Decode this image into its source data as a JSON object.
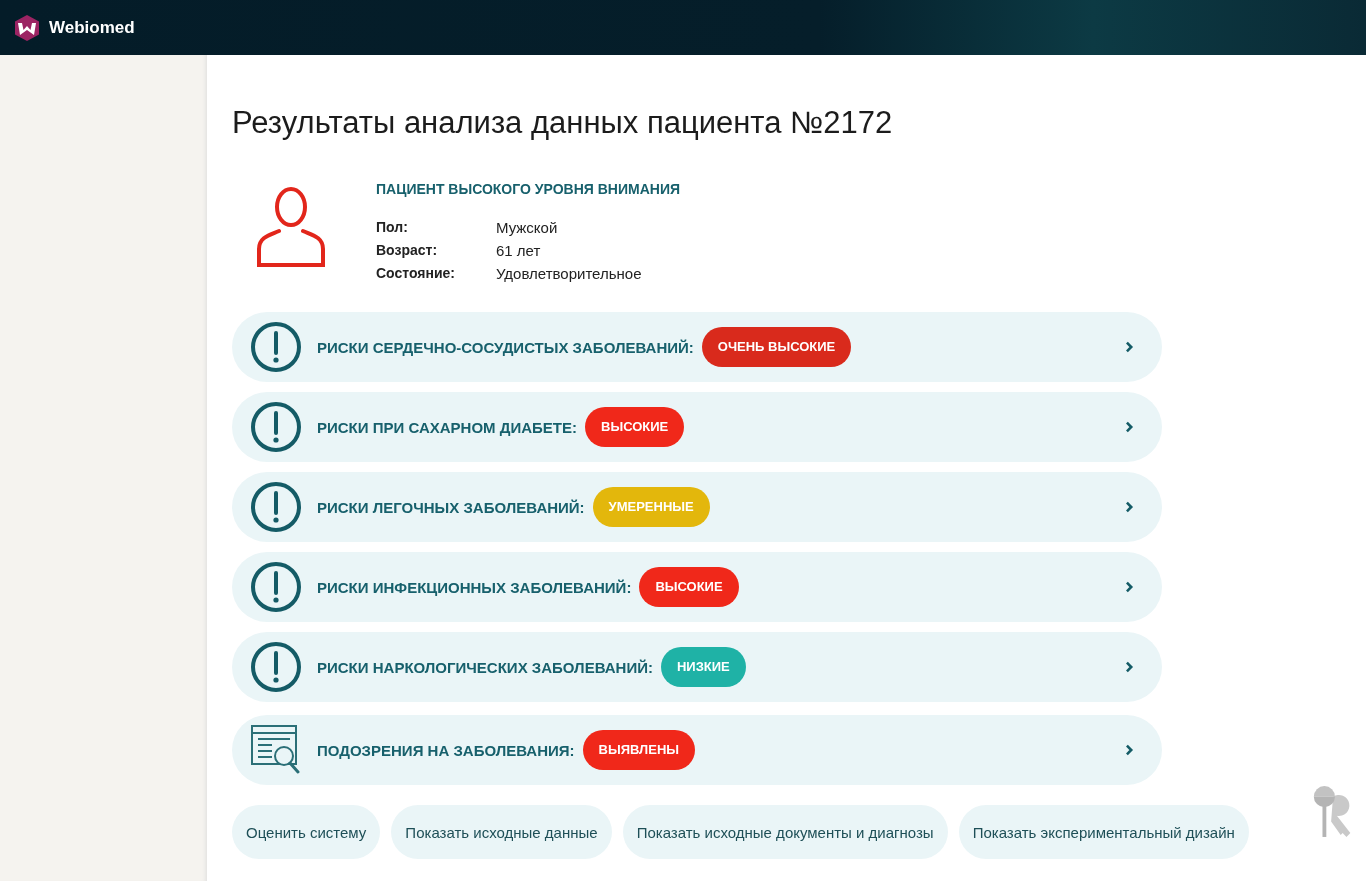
{
  "header": {
    "brand": "Webiomed"
  },
  "title": "Результаты анализа данных пациента №2172",
  "patient": {
    "category": "ПАЦИЕНТ ВЫСОКОГО УРОВНЯ ВНИМАНИЯ",
    "fields": [
      {
        "label": "Пол:",
        "value": "Мужской"
      },
      {
        "label": "Возраст:",
        "value": "61 лет"
      },
      {
        "label": "Состояние:",
        "value": "Удовлетворительное"
      }
    ]
  },
  "risks": [
    {
      "kind": "alert",
      "label": "РИСКИ СЕРДЕЧНО-СОСУДИСТЫХ ЗАБОЛЕВАНИЙ:",
      "badge": "ОЧЕНЬ ВЫСОКИЕ",
      "color": "#d92a1c"
    },
    {
      "kind": "alert",
      "label": "РИСКИ ПРИ САХАРНОМ ДИАБЕТЕ:",
      "badge": "ВЫСОКИЕ",
      "color": "#f0281a"
    },
    {
      "kind": "alert",
      "label": "РИСКИ ЛЕГОЧНЫХ ЗАБОЛЕВАНИЙ:",
      "badge": "УМЕРЕННЫЕ",
      "color": "#e3b70c"
    },
    {
      "kind": "alert",
      "label": "РИСКИ ИНФЕКЦИОННЫХ ЗАБОЛЕВАНИЙ:",
      "badge": "ВЫСОКИЕ",
      "color": "#f0281a"
    },
    {
      "kind": "alert",
      "label": "РИСКИ НАРКОЛОГИЧЕСКИХ ЗАБОЛЕВАНИЙ:",
      "badge": "НИЗКИЕ",
      "color": "#1fb2a6"
    },
    {
      "kind": "search",
      "label": "ПОДОЗРЕНИЯ НА ЗАБОЛЕВАНИЯ:",
      "badge": "ВЫЯВЛЕНЫ",
      "color": "#f0281a"
    }
  ],
  "buttons": [
    "Оценить систему",
    "Показать исходные данные",
    "Показать исходные документы и диагнозы",
    "Показать экспериментальный дизайн"
  ]
}
